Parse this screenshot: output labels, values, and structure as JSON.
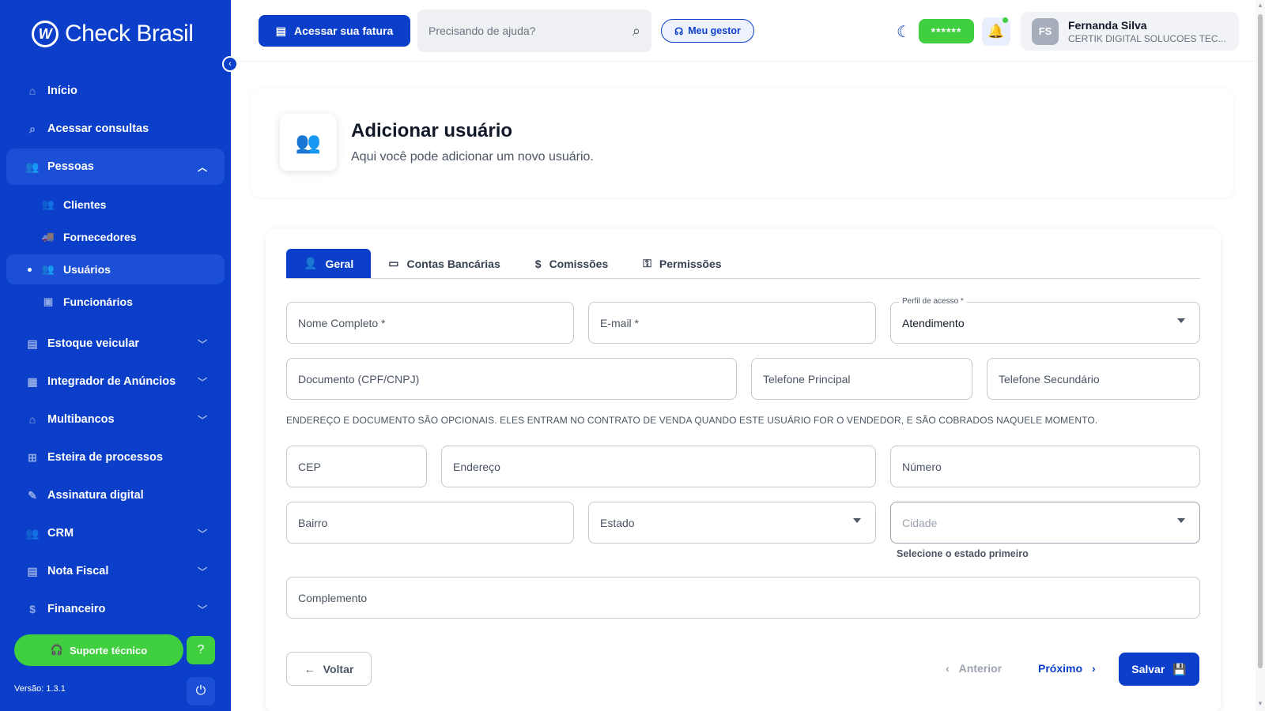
{
  "brand": {
    "name": "Check Brasil",
    "mark": "W"
  },
  "sidebar": {
    "items": [
      {
        "label": "Início",
        "icon": "home-icon",
        "glyph": "⌂"
      },
      {
        "label": "Acessar consultas",
        "icon": "search-icon",
        "glyph": "⌕"
      },
      {
        "label": "Pessoas",
        "icon": "people-icon",
        "glyph": "👥",
        "expanded": true
      }
    ],
    "sub_items": [
      {
        "label": "Clientes",
        "icon": "clients-icon",
        "glyph": "👥"
      },
      {
        "label": "Fornecedores",
        "icon": "truck-icon",
        "glyph": "🚚"
      },
      {
        "label": "Usuários",
        "icon": "users-icon",
        "glyph": "👥",
        "active": true
      },
      {
        "label": "Funcionários",
        "icon": "badge-icon",
        "glyph": "▣"
      }
    ],
    "more_items": [
      {
        "label": "Estoque veicular",
        "icon": "garage-icon",
        "glyph": "▤",
        "has_chevron": true
      },
      {
        "label": "Integrador de Anúncios",
        "icon": "ads-icon",
        "glyph": "▦",
        "has_chevron": true
      },
      {
        "label": "Multibancos",
        "icon": "bank-icon",
        "glyph": "⌂",
        "has_chevron": true
      },
      {
        "label": "Esteira de processos",
        "icon": "flow-icon",
        "glyph": "⊞",
        "has_chevron": false
      },
      {
        "label": "Assinatura digital",
        "icon": "signature-icon",
        "glyph": "✎",
        "has_chevron": false
      },
      {
        "label": "CRM",
        "icon": "crm-icon",
        "glyph": "👥",
        "has_chevron": true
      },
      {
        "label": "Nota Fiscal",
        "icon": "invoice-icon",
        "glyph": "▤",
        "has_chevron": true
      },
      {
        "label": "Financeiro",
        "icon": "money-icon",
        "glyph": "$",
        "has_chevron": true
      }
    ],
    "support_label": "Suporte técnico",
    "version": "Versão: 1.3.1"
  },
  "topbar": {
    "fatura_label": "Acessar sua fatura",
    "search_placeholder": "Precisando de ajuda?",
    "gestor_label": "Meu gestor",
    "balance_masked": "******",
    "user_initials": "FS",
    "user_name": "Fernanda Silva",
    "user_company": "CERTIK DIGITAL SOLUCOES TEC..."
  },
  "header": {
    "title": "Adicionar usuário",
    "subtitle": "Aqui você pode adicionar um novo usuário."
  },
  "tabs": [
    {
      "label": "Geral",
      "icon": "person-icon",
      "glyph": "👤",
      "active": true
    },
    {
      "label": "Contas Bancárias",
      "icon": "card-icon",
      "glyph": "▭",
      "active": false
    },
    {
      "label": "Comissões",
      "icon": "dollar-icon",
      "glyph": "$",
      "active": false
    },
    {
      "label": "Permissões",
      "icon": "key-icon",
      "glyph": "⚿",
      "active": false
    }
  ],
  "form": {
    "nome": "Nome Completo *",
    "email": "E-mail *",
    "perfil_label": "Perfil de acesso *",
    "perfil_value": "Atendimento",
    "documento": "Documento (CPF/CNPJ)",
    "telefone_principal": "Telefone Principal",
    "telefone_secundario": "Telefone Secundário",
    "notice": "ENDEREÇO E DOCUMENTO SÃO OPCIONAIS. ELES ENTRAM NO CONTRATO DE VENDA QUANDO ESTE USUÁRIO FOR O VENDEDOR, E SÃO COBRADOS NAQUELE MOMENTO.",
    "cep": "CEP",
    "endereco": "Endereço",
    "numero": "Número",
    "bairro": "Bairro",
    "estado": "Estado",
    "cidade": "Cidade",
    "cidade_helper": "Selecione o estado primeiro",
    "complemento": "Complemento"
  },
  "actions": {
    "back": "Voltar",
    "prev": "Anterior",
    "next": "Próximo",
    "save": "Salvar"
  },
  "colors": {
    "primary": "#0b3fc9",
    "accent_green": "#3fcf3f"
  }
}
